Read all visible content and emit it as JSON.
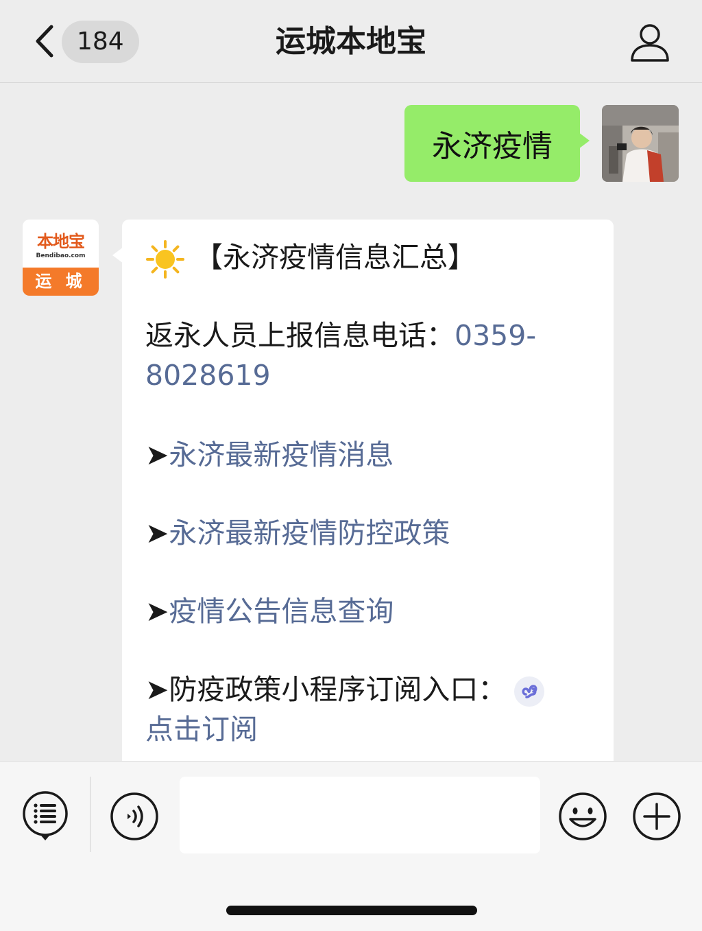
{
  "header": {
    "unread_count": "184",
    "title": "运城本地宝"
  },
  "messages": {
    "outgoing_text": "永济疫情",
    "bot_avatar": {
      "logo_text": "本地宝",
      "logo_sub": "Bendibao.com",
      "city": "运 城"
    },
    "incoming": {
      "heading": "【永济疫情信息汇总】",
      "phone_label": "返永人员上报信息电话：",
      "phone_part1": "0359-",
      "phone_part2": "8028619",
      "arrow": "➤",
      "links": [
        "永济最新疫情消息",
        "永济最新疫情防控政策",
        "疫情公告信息查询"
      ],
      "mini_program_label": "防疫政策小程序订阅入口：",
      "subscribe_link": "点击订阅"
    }
  },
  "toolbar": {
    "input_value": ""
  },
  "colors": {
    "link": "#576b95",
    "outgoing_bubble": "#95ec69",
    "background": "#ededed",
    "brand_orange": "#f47a2a"
  }
}
